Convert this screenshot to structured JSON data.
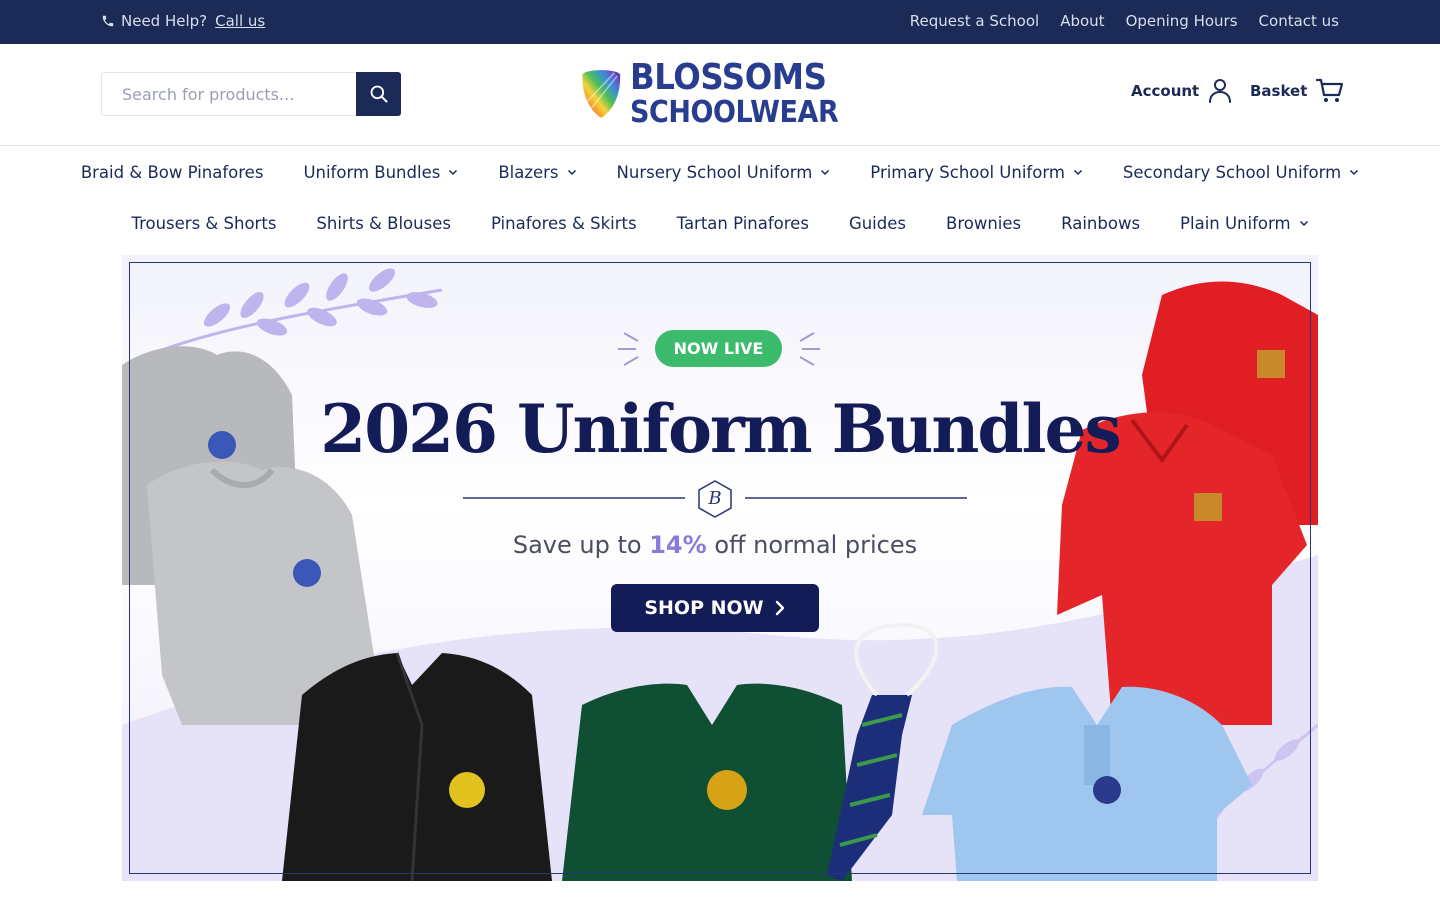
{
  "topbar": {
    "help_text": "Need Help?",
    "call_link": "Call us",
    "links": [
      "Request a School",
      "About",
      "Opening Hours",
      "Contact us"
    ]
  },
  "header": {
    "search_placeholder": "Search for products...",
    "logo_line1": "BLOSSOMS",
    "logo_line2": "SCHOOLWEAR",
    "account_label": "Account",
    "basket_label": "Basket"
  },
  "nav": {
    "row1": [
      {
        "label": "Braid & Bow Pinafores",
        "dropdown": false
      },
      {
        "label": "Uniform Bundles",
        "dropdown": true
      },
      {
        "label": "Blazers",
        "dropdown": true
      },
      {
        "label": "Nursery School Uniform",
        "dropdown": true
      },
      {
        "label": "Primary School Uniform",
        "dropdown": true
      },
      {
        "label": "Secondary School Uniform",
        "dropdown": true
      }
    ],
    "row2": [
      {
        "label": "Trousers & Shorts",
        "dropdown": false
      },
      {
        "label": "Shirts & Blouses",
        "dropdown": false
      },
      {
        "label": "Pinafores & Skirts",
        "dropdown": false
      },
      {
        "label": "Tartan Pinafores",
        "dropdown": false
      },
      {
        "label": "Guides",
        "dropdown": false
      },
      {
        "label": "Brownies",
        "dropdown": false
      },
      {
        "label": "Rainbows",
        "dropdown": false
      },
      {
        "label": "Plain Uniform",
        "dropdown": true
      }
    ]
  },
  "banner": {
    "badge": "NOW LIVE",
    "title": "2026 Uniform Bundles",
    "subtitle_pre": "Save up to",
    "subtitle_pct": "14%",
    "subtitle_post": "off normal prices",
    "cta": "SHOP NOW",
    "monogram": "B"
  },
  "colors": {
    "navy": "#1b2a57",
    "banner_navy": "#131c57",
    "green_badge": "#3dbb6c",
    "lavender": "#8b7ad7"
  }
}
